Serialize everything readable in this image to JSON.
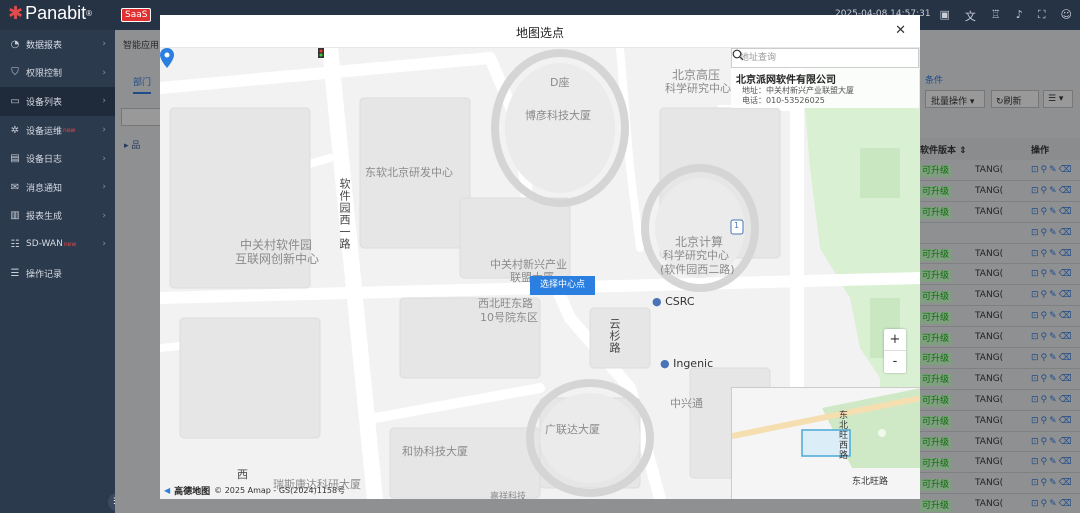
{
  "app": {
    "brand": "Panabit",
    "badge": "SaaS",
    "datetime": "2025-04-08 14:57:31"
  },
  "sidebar": {
    "items": [
      {
        "label": "数据报表",
        "icon": "dashboard-icon",
        "new": ""
      },
      {
        "label": "权限控制",
        "icon": "shield-icon",
        "new": ""
      },
      {
        "label": "设备列表",
        "icon": "device-icon",
        "new": ""
      },
      {
        "label": "设备运维",
        "icon": "gear-icon",
        "new": "new"
      },
      {
        "label": "设备日志",
        "icon": "log-icon",
        "new": ""
      },
      {
        "label": "消息通知",
        "icon": "mail-icon",
        "new": ""
      },
      {
        "label": "报表生成",
        "icon": "report-icon",
        "new": ""
      },
      {
        "label": "SD-WAN",
        "icon": "sdwan-icon",
        "new": "new"
      },
      {
        "label": "操作记录",
        "icon": "record-icon",
        "new": ""
      }
    ]
  },
  "content": {
    "breadcrumb": "智能应用",
    "tab": "部门",
    "tree_root": "▸ 品",
    "more_conditions": "条件",
    "batch_label": "批量操作",
    "refresh_label": "刷新",
    "table": {
      "headers": [
        "软件版本 ⇕",
        "操作"
      ],
      "rows": [
        {
          "status": "可升级",
          "tag": "TANG("
        },
        {
          "status": "可升级",
          "tag": "TANG("
        },
        {
          "status": "可升级",
          "tag": "TANG("
        },
        {
          "status": "",
          "tag": ""
        },
        {
          "status": "可升级",
          "tag": "TANG("
        },
        {
          "status": "可升级",
          "tag": "TANG("
        },
        {
          "status": "可升级",
          "tag": "TANG("
        },
        {
          "status": "可升级",
          "tag": "TANG("
        },
        {
          "status": "可升级",
          "tag": "TANG("
        },
        {
          "status": "可升级",
          "tag": "TANG("
        },
        {
          "status": "可升级",
          "tag": "TANG("
        },
        {
          "status": "可升级",
          "tag": "TANG("
        },
        {
          "status": "可升级",
          "tag": "TANG("
        },
        {
          "status": "可升级",
          "tag": "TANG("
        },
        {
          "status": "可升级",
          "tag": "TANG("
        },
        {
          "status": "可升级",
          "tag": "TANG("
        },
        {
          "status": "可升级",
          "tag": "TANG("
        }
      ]
    }
  },
  "modal": {
    "title": "地图选点",
    "search_placeholder": "地址查询",
    "poi": {
      "name": "北京派网软件有限公司",
      "address": "地址：中关村新兴产业联盟大厦",
      "phone": "电话：010-53526025"
    },
    "select_button": "选择中心点",
    "zoom_in": "+",
    "zoom_out": "-",
    "attribution": "© 2025 Amap - GS(2024)1158号",
    "amap_logo": "高德地图"
  },
  "map_labels": {
    "d_building": "D座",
    "beijing_gaoya": "北京高压",
    "gaoya_sub": "科学研究中心",
    "boyan": "博彦科技大厦",
    "dongruan": "东软北京研发中心",
    "ruanjian_xierlu": "软件园西一路",
    "zhongguancun_1": "中关村软件园",
    "zhongguancun_2": "互联网创新中心",
    "zgc_new_1": "中关村新兴产业",
    "zgc_new_2": "联盟大厦",
    "xibeiwang_1": "西北旺东路",
    "xibeiwang_2": "10号院东区",
    "jisuan_1": "北京计算",
    "jisuan_2": "科学研究中心",
    "jisuan_3": "(软件园西二路)",
    "csrc": "CSRC",
    "yunshanlu": "云杉路",
    "ingenic": "Ingenic",
    "zhongxing": "中兴通",
    "guanglianda": "广联达大厦",
    "hexie": "和协科技大厦",
    "ruisi": "瑞斯康达科研大厦",
    "xi": "西",
    "yuanxiang": "嘉祥科技",
    "road_num": "1",
    "mini_road_1": "东北旺西路",
    "mini_road_2": "东北旺路"
  }
}
